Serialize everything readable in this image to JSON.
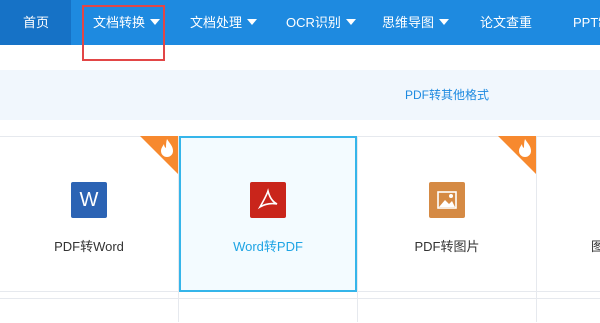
{
  "nav": {
    "items": [
      {
        "label": "首页"
      },
      {
        "label": "文档转换"
      },
      {
        "label": "文档处理"
      },
      {
        "label": "OCR识别"
      },
      {
        "label": "思维导图"
      },
      {
        "label": "论文查重"
      },
      {
        "label": "PPT制"
      }
    ],
    "colors": {
      "bar": "#1e8ae0",
      "home": "#1672c6",
      "highlight": "#e24646"
    }
  },
  "sub_nav": {
    "active_tab": "PDF转其他格式",
    "color": "#1e8ae0"
  },
  "tools": [
    {
      "label": "PDF转Word",
      "icon": "word-file-icon",
      "glyph": "W",
      "hot": true,
      "selected": false,
      "color": "#2b63b4"
    },
    {
      "label": "Word转PDF",
      "icon": "pdf-file-icon",
      "glyph": "✒",
      "hot": false,
      "selected": true,
      "color": "#c9251b"
    },
    {
      "label": "PDF转图片",
      "icon": "image-file-icon",
      "glyph": "▲",
      "hot": true,
      "selected": false,
      "color": "#d58a44"
    },
    {
      "label": "图",
      "icon": "",
      "glyph": "",
      "hot": false,
      "selected": false,
      "color": ""
    }
  ]
}
